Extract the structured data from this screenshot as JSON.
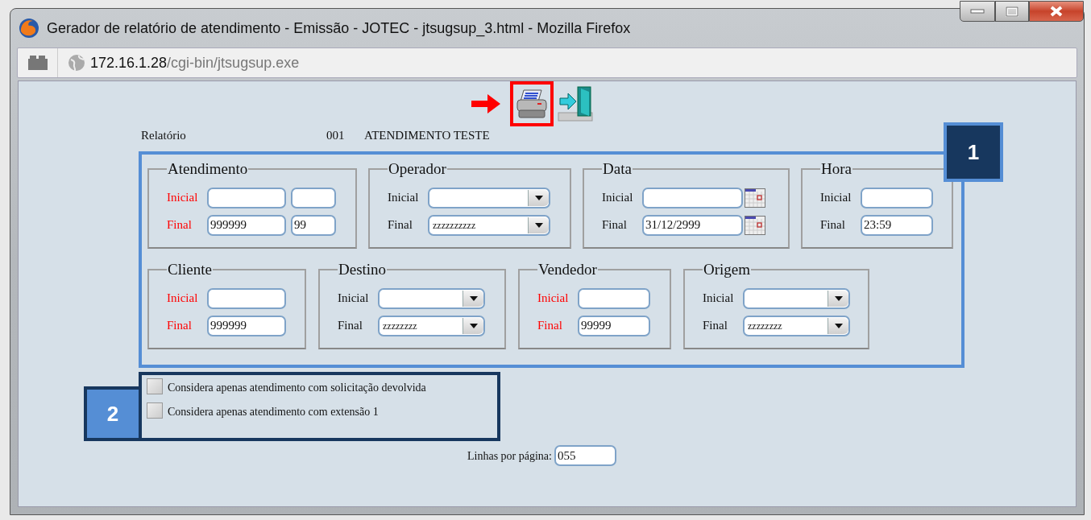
{
  "window": {
    "title": "Gerador de relatório de atendimento - Emissão - JOTEC - jtsugsup_3.html - Mozilla Firefox"
  },
  "address_bar": {
    "host": "172.16.1.28",
    "path": "/cgi-bin/jtsugsup.exe"
  },
  "toolbar": {
    "print_highlighted": true
  },
  "report": {
    "label": "Relatório",
    "code": "001",
    "name": "ATENDIMENTO TESTE"
  },
  "filters": {
    "badge": "1",
    "group_rows": [
      {
        "groups": [
          {
            "title": "Atendimento",
            "fields": [
              {
                "label": "Inicial",
                "required": true,
                "kind": "text"
              },
              {
                "label": "Final",
                "required": true,
                "kind": "text",
                "values": [
                  "999999",
                  "99"
                ]
              }
            ]
          },
          {
            "title": "Operador",
            "fields": [
              {
                "label": "Inicial",
                "required": false,
                "kind": "select"
              },
              {
                "label": "Final",
                "required": false,
                "kind": "select",
                "values": [
                  "zzzzzzzzzz"
                ]
              }
            ]
          },
          {
            "title": "Data",
            "fields": [
              {
                "label": "Inicial",
                "required": false,
                "kind": "date"
              },
              {
                "label": "Final",
                "required": false,
                "kind": "date",
                "values": [
                  "31/12/2999"
                ]
              }
            ]
          },
          {
            "title": "Hora",
            "fields": [
              {
                "label": "Inicial",
                "required": false,
                "kind": "text"
              },
              {
                "label": "Final",
                "required": false,
                "kind": "text",
                "values": [
                  "23:59"
                ]
              }
            ]
          }
        ]
      },
      {
        "groups": [
          {
            "title": "Cliente",
            "fields": [
              {
                "label": "Inicial",
                "required": true,
                "kind": "text"
              },
              {
                "label": "Final",
                "required": true,
                "kind": "text",
                "values": [
                  "999999"
                ]
              }
            ]
          },
          {
            "title": "Destino",
            "fields": [
              {
                "label": "Inicial",
                "required": false,
                "kind": "select"
              },
              {
                "label": "Final",
                "required": false,
                "kind": "select",
                "values": [
                  "zzzzzzzz"
                ]
              }
            ]
          },
          {
            "title": "Vendedor",
            "fields": [
              {
                "label": "Inicial",
                "required": true,
                "kind": "text"
              },
              {
                "label": "Final",
                "required": true,
                "kind": "text",
                "values": [
                  "99999"
                ]
              }
            ]
          },
          {
            "title": "Origem",
            "fields": [
              {
                "label": "Inicial",
                "required": false,
                "kind": "select"
              },
              {
                "label": "Final",
                "required": false,
                "kind": "select",
                "values": [
                  "zzzzzzzz"
                ]
              }
            ]
          }
        ]
      }
    ]
  },
  "options": {
    "badge": "2",
    "items": [
      {
        "label": "Considera apenas atendimento com solicitação devolvida",
        "checked": false
      },
      {
        "label": "Considera apenas atendimento com extensão 1",
        "checked": false
      }
    ]
  },
  "lines_per_page": {
    "label": "Linhas por página:",
    "value": "055"
  }
}
